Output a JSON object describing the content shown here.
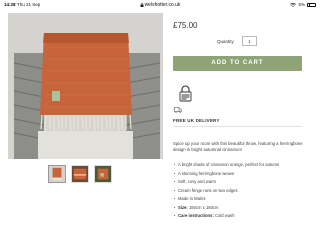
{
  "status_bar": {
    "time": "14:28",
    "date": "Thu 21 Sep",
    "url": "welshotter.co.uk",
    "battery": "5%"
  },
  "product": {
    "price": "£75.00",
    "quantity_label": "Quantity",
    "quantity_value": "1",
    "add_to_cart_label": "ADD TO CART",
    "free_delivery_label": "FREE UK DELIVERY",
    "description": "Spice up your room with this beautiful throw, featuring a herringbone design in bright autumnal cinnamon!",
    "features": [
      {
        "label": "",
        "text": "A bright shade of cinnamon orange, perfect for autumn"
      },
      {
        "label": "",
        "text": "A stunning herringbone weave"
      },
      {
        "label": "",
        "text": "Soft, cosy and warm"
      },
      {
        "label": "",
        "text": "Cream fringe runs on two edges"
      },
      {
        "label": "",
        "text": "Made in Wales"
      },
      {
        "label": "Size:",
        "text": "150cm x 180cm"
      },
      {
        "label": "Care instructions:",
        "text": "Cold wash"
      }
    ]
  },
  "colors": {
    "accent_button": "#8ea376",
    "throw_orange": "#c8643a",
    "fringe_cream": "#ece4d2"
  },
  "icons": [
    "lock-icon",
    "wifi-icon",
    "battery-icon",
    "sustainability-badge-icon"
  ]
}
